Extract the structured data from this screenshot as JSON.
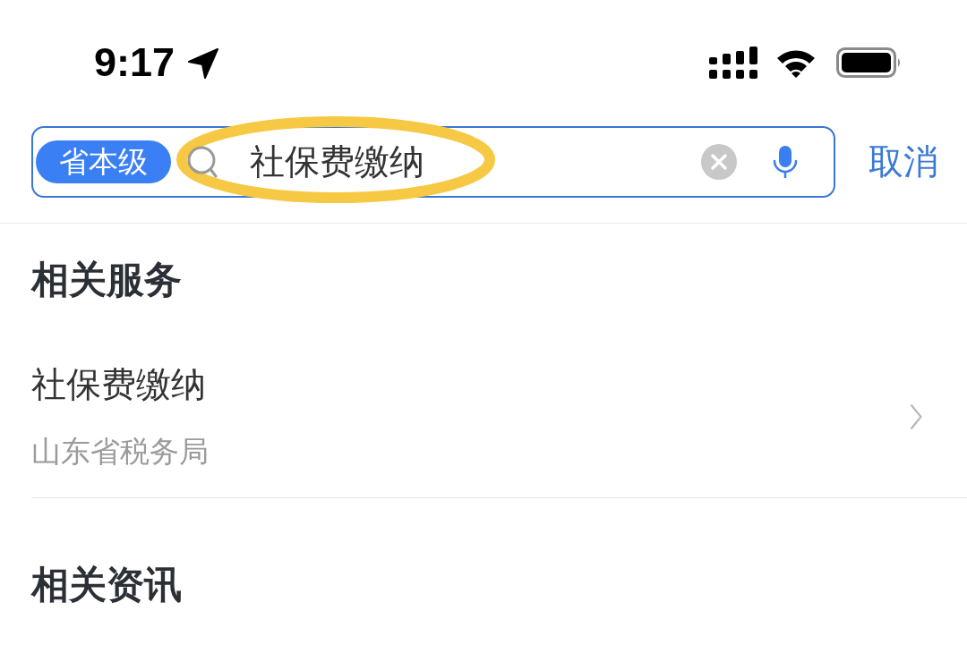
{
  "status_bar": {
    "time": "9:17"
  },
  "search": {
    "scope_tag": "省本级",
    "value": "社保费缴纳",
    "highlighted": true,
    "cancel": "取消"
  },
  "sections": [
    {
      "title": "相关服务",
      "items": [
        {
          "title": "社保费缴纳",
          "subtitle": "山东省税务局"
        }
      ]
    },
    {
      "title": "相关资讯"
    }
  ]
}
